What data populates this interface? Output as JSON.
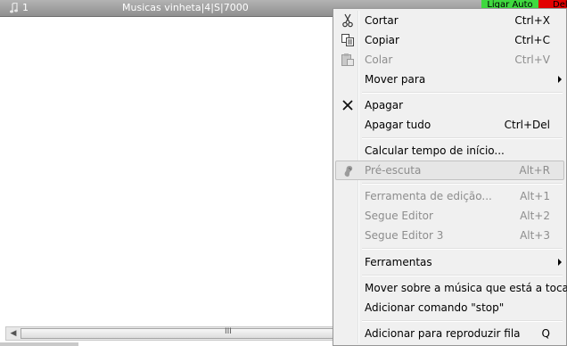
{
  "row": {
    "index": "1",
    "title": "Musicas vinheta|4|S|7000",
    "auto_button": "Ligar Auto",
    "del_button": "Del"
  },
  "scrollbar": {
    "grip": "III",
    "left_arrow": "◀"
  },
  "menu": {
    "cut": {
      "label": "Cortar",
      "shortcut": "Ctrl+X"
    },
    "copy": {
      "label": "Copiar",
      "shortcut": "Ctrl+C"
    },
    "paste": {
      "label": "Colar",
      "shortcut": "Ctrl+V"
    },
    "move_to": {
      "label": "Mover para"
    },
    "delete": {
      "label": "Apagar"
    },
    "delete_all": {
      "label": "Apagar tudo",
      "shortcut": "Ctrl+Del"
    },
    "calc_start": {
      "label": "Calcular tempo de início..."
    },
    "prelisten": {
      "label": "Pré-escuta",
      "shortcut": "Alt+R"
    },
    "edit_tool": {
      "label": "Ferramenta de edição...",
      "shortcut": "Alt+1"
    },
    "follow_editor": {
      "label": "Segue Editor",
      "shortcut": "Alt+2"
    },
    "follow_editor3": {
      "label": "Segue Editor 3",
      "shortcut": "Alt+3"
    },
    "tools": {
      "label": "Ferramentas"
    },
    "move_over": {
      "label": "Mover sobre a música que está a tocar"
    },
    "add_stop": {
      "label": "Adicionar comando \"stop\""
    },
    "add_queue": {
      "label": "Adicionar para reproduzir fila",
      "shortcut": "Q"
    }
  },
  "icons": {
    "note": "music-note-icon",
    "cut": "scissors-icon",
    "copy": "copy-icon",
    "paste": "clipboard-icon",
    "delete": "x-icon",
    "prelisten": "ear-icon"
  },
  "colors": {
    "auto_button": "#3fd93f",
    "del_button": "#e20000",
    "menu_bg": "#f0f0f0",
    "disabled_text": "#8d8d8d"
  }
}
